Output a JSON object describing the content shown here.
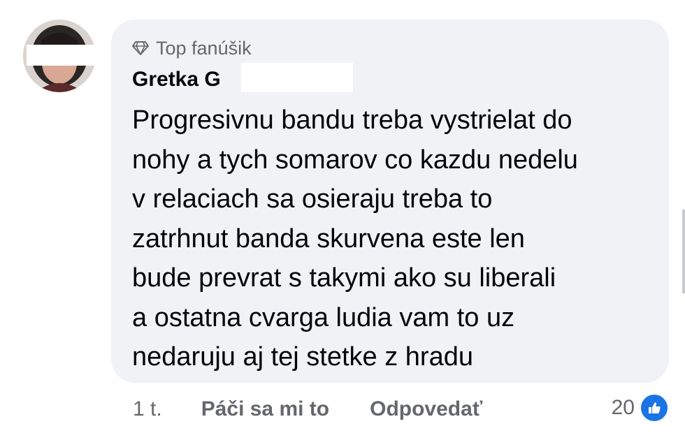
{
  "comment": {
    "badge_label": "Top fanúšik",
    "author_name": "Gretka G",
    "text_lines": [
      "Progresivnu bandu treba vystrielat do",
      "nohy a tych somarov co kazdu nedelu",
      "v relaciach sa osieraju treba to",
      "zatrhnut banda skurvena este len",
      "bude prevrat s takymi ako su liberali",
      "a ostatna cvarga ludia vam to uz",
      "nedaruju aj tej stetke z hradu"
    ]
  },
  "actions": {
    "time": "1 t.",
    "like_label": "Páči sa mi to",
    "reply_label": "Odpovedať"
  },
  "reactions": {
    "count": "20",
    "icon": "thumbs-up-icon",
    "color": "#1b74e4"
  },
  "colors": {
    "bubble": "#f0f2f5",
    "secondary_text": "#65676b",
    "primary_text": "#050505"
  }
}
